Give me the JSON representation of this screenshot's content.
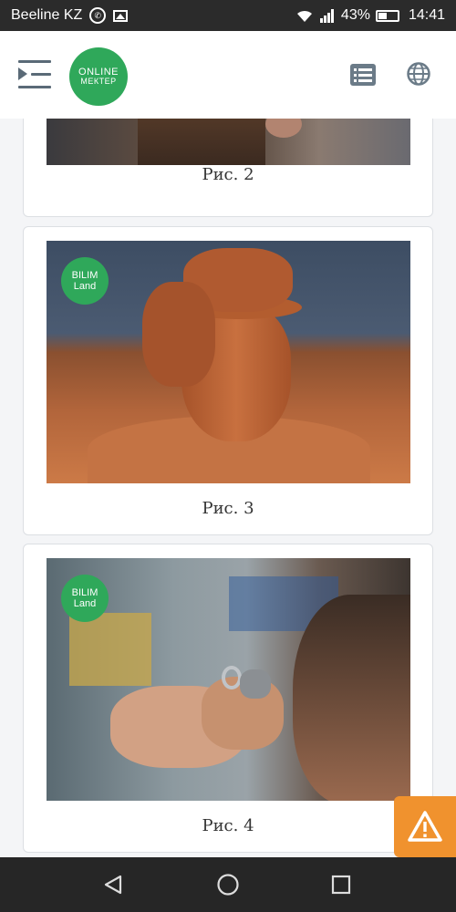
{
  "status_bar": {
    "carrier": "Beeline KZ",
    "battery": "43%",
    "time": "14:41",
    "icons": [
      "whatsapp-icon",
      "image-icon",
      "wifi-icon",
      "signal-icon",
      "battery-icon"
    ]
  },
  "header": {
    "logo_line1": "ONLINE",
    "logo_line2": "МЕКТЕР",
    "icons": [
      "menu-icon",
      "list-icon",
      "globe-icon"
    ]
  },
  "figures": [
    {
      "caption": "Рис. 2",
      "watermark": false
    },
    {
      "caption": "Рис. 3",
      "watermark": true,
      "watermark_line1": "BILIM",
      "watermark_line2": "Land"
    },
    {
      "caption": "Рис. 4",
      "watermark": true,
      "watermark_line1": "BILIM",
      "watermark_line2": "Land"
    }
  ],
  "colors": {
    "brand_green": "#2fa85a",
    "alert_orange": "#f0922e",
    "status_bar": "#2b2b2b",
    "nav_bar": "#262626"
  },
  "floating": {
    "alert_icon": "warning-icon"
  },
  "nav_bar": {
    "icons": [
      "back-icon",
      "home-icon",
      "recents-icon"
    ]
  }
}
